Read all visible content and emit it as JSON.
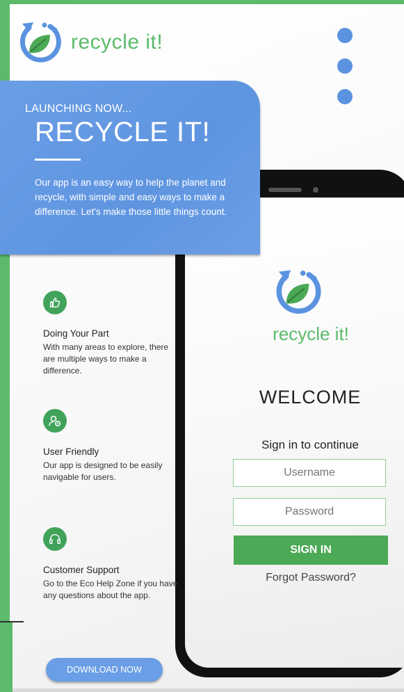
{
  "brand": {
    "name": "recycle it!",
    "colors": {
      "green": "#5bbb6a",
      "blue": "#5f95e0",
      "button_green": "#4ca956"
    }
  },
  "menu": {
    "icon": "vertical-dots-icon"
  },
  "hero": {
    "kicker": "LAUNCHING NOW...",
    "title": "RECYCLE IT!",
    "body": "Our app is an easy way to help the planet and recycle, with simple and easy ways to make a difference. Let's make those little things count."
  },
  "features": [
    {
      "icon": "thumbs-up-icon",
      "title": "Doing Your Part",
      "desc": "With many areas to explore, there are multiple ways to make a difference."
    },
    {
      "icon": "user-settings-icon",
      "title": "User Friendly",
      "desc": "Our app is designed to be easily navigable for users."
    },
    {
      "icon": "headset-icon",
      "title": "Customer Support",
      "desc": "Go to the Eco Help Zone if you have any questions about the app."
    }
  ],
  "download": {
    "label": "DOWNLOAD NOW"
  },
  "phone": {
    "brand": "recycle it!",
    "welcome": "WELCOME",
    "subtitle": "Sign in to continue",
    "username_placeholder": "Username",
    "password_placeholder": "Password",
    "signin_label": "SIGN IN",
    "forgot_label": "Forgot Password?"
  }
}
